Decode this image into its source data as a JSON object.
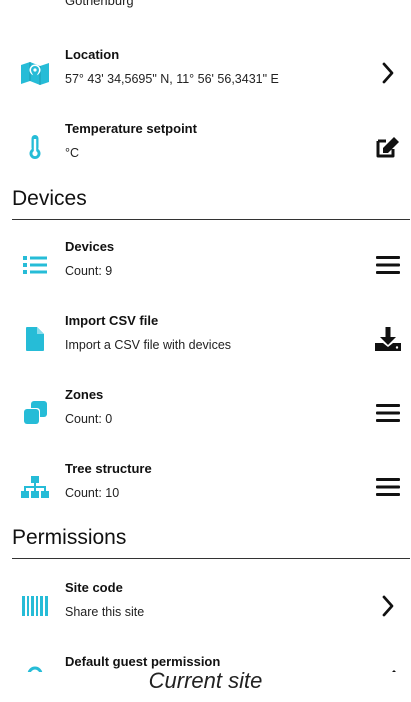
{
  "colors": {
    "accent": "#26bcd7",
    "text": "#111111"
  },
  "top_cutoff_text": "Gothenburg",
  "site_rows": [
    {
      "icon": "map-icon",
      "title": "Location",
      "sub": "57° 43' 34,5695\" N, 11° 56' 56,3431\" E",
      "action": "chevron-right-icon"
    },
    {
      "icon": "thermometer-icon",
      "title": "Temperature setpoint",
      "sub": "°C",
      "action": "edit-icon"
    }
  ],
  "devices_section": {
    "header": "Devices",
    "rows": [
      {
        "icon": "list-icon",
        "title": "Devices",
        "sub": "Count: 9",
        "action": "menu-icon"
      },
      {
        "icon": "file-icon",
        "title": "Import CSV file",
        "sub": "Import a CSV file with devices",
        "action": "download-icon"
      },
      {
        "icon": "zones-icon",
        "title": "Zones",
        "sub": "Count: 0",
        "action": "menu-icon"
      },
      {
        "icon": "sitemap-icon",
        "title": "Tree structure",
        "sub": "Count: 10",
        "action": "menu-icon"
      }
    ]
  },
  "permissions_section": {
    "header": "Permissions",
    "rows": [
      {
        "icon": "barcode-icon",
        "title": "Site code",
        "sub": "Share this site",
        "action": "chevron-right-icon"
      },
      {
        "icon": "lock-icon",
        "title": "Default guest permission",
        "sub": "",
        "action": "edit-icon"
      }
    ]
  },
  "footer": {
    "title": "Current site"
  }
}
